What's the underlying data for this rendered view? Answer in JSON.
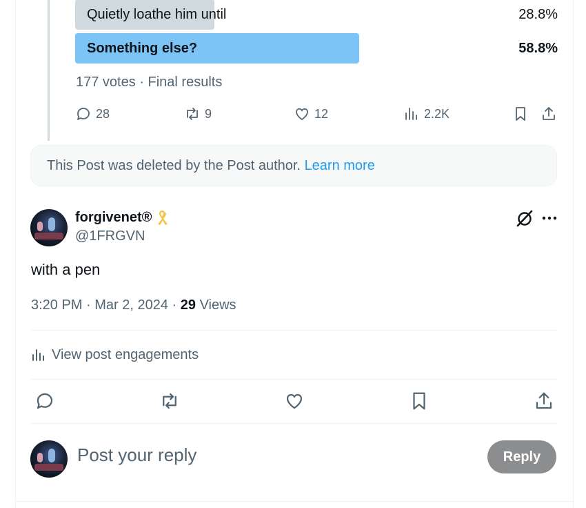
{
  "poll": {
    "options": [
      {
        "label": "Quietly loathe him until",
        "percent": "28.8%",
        "fraction": 0.288,
        "color": "#cfd9de"
      },
      {
        "label": "Something else?",
        "percent": "58.8%",
        "fraction": 0.588,
        "color": "#7cc3f6"
      }
    ],
    "meta": "177 votes · Final results"
  },
  "quoted_actions": {
    "replies": "28",
    "reposts": "9",
    "likes": "12",
    "views": "2.2K"
  },
  "deleted_notice": {
    "text": "This Post was deleted by the Post author.",
    "link": "Learn more"
  },
  "post": {
    "author_name": "forgivenet®",
    "handle": "@1FRGVN",
    "text": "with a pen",
    "timestamp": "3:20 PM · Mar 2, 2024 · ",
    "views_count": "29",
    "views_label": " Views",
    "engagements_label": "View post engagements"
  },
  "reply": {
    "placeholder": "Post your reply",
    "button_label": "Reply"
  },
  "colors": {
    "accent": "#1d9bf0",
    "muted_text": "#536471",
    "ribbon": "#f6c343"
  }
}
